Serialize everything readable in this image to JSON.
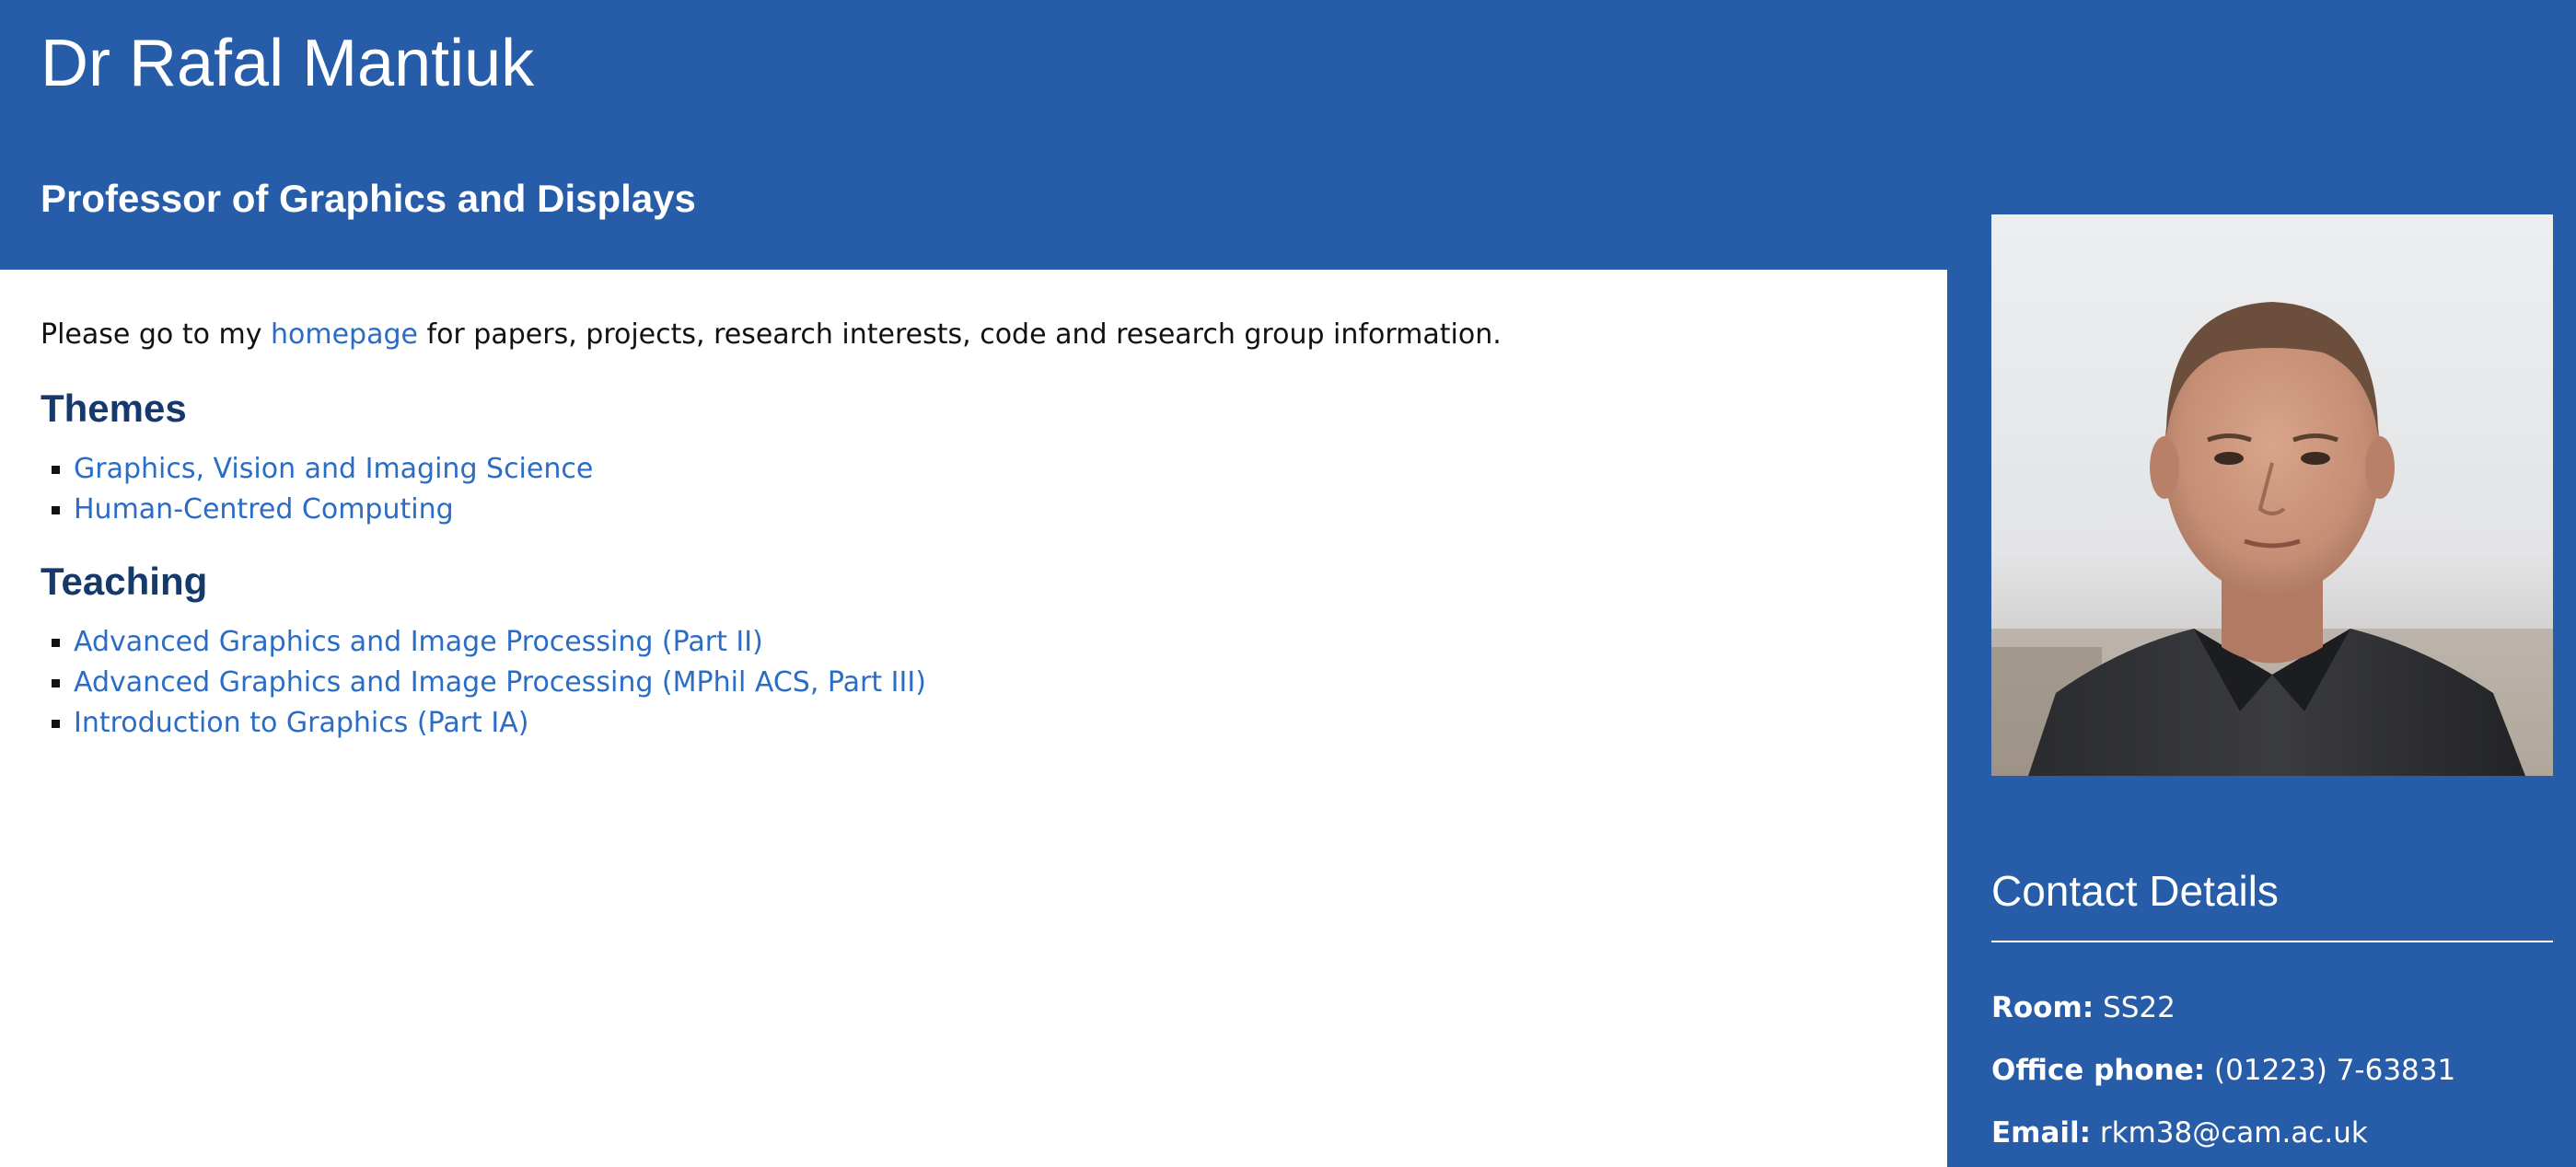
{
  "header": {
    "name": "Dr Rafal Mantiuk",
    "job_title": "Professor of Graphics and Displays",
    "background_color": "#265ca8"
  },
  "intro": {
    "before": "Please go to my ",
    "link": "homepage",
    "after": " for papers, projects, research interests, code and research group information."
  },
  "themes": {
    "heading": "Themes",
    "items": [
      "Graphics, Vision and Imaging Science",
      "Human-Centred Computing"
    ]
  },
  "teaching": {
    "heading": "Teaching",
    "items": [
      "Advanced Graphics and Image Processing (Part II)",
      "Advanced Graphics and Image Processing (MPhil ACS, Part III)",
      "Introduction to Graphics (Part IA)"
    ]
  },
  "contact": {
    "heading": "Contact Details",
    "room_label": "Room:",
    "room": "SS22",
    "phone_label": "Office phone:",
    "phone": "(01223) 7-63831",
    "email_label": "Email:",
    "email": "rkm38@cam.ac.uk"
  },
  "colors": {
    "link": "#2b6cc4",
    "heading": "#16396b",
    "brand_blue": "#265ca8"
  }
}
